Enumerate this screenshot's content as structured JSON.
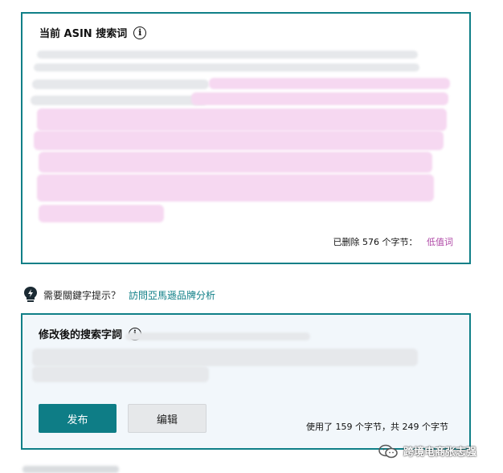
{
  "current_panel": {
    "title": "当前 ASIN 搜索词",
    "deleted_prefix": "已删除 576 个字节：",
    "low_value_label": "低值词"
  },
  "hint": {
    "text": "需要關鍵字提示？",
    "link": "訪問亞馬遜品牌分析"
  },
  "modified_panel": {
    "title": "修改後的搜索字詞",
    "publish_label": "发布",
    "edit_label": "编辑",
    "byte_count": "使用了 159 个字节，共 249 个字节"
  },
  "watermark": "跨境电商张志强",
  "colors": {
    "accent": "#0f7f87",
    "low_value": "#b04aa7",
    "button_primary": "#0e7d86"
  },
  "icons": [
    "info-icon",
    "lightbulb-icon",
    "wechat-icon"
  ]
}
